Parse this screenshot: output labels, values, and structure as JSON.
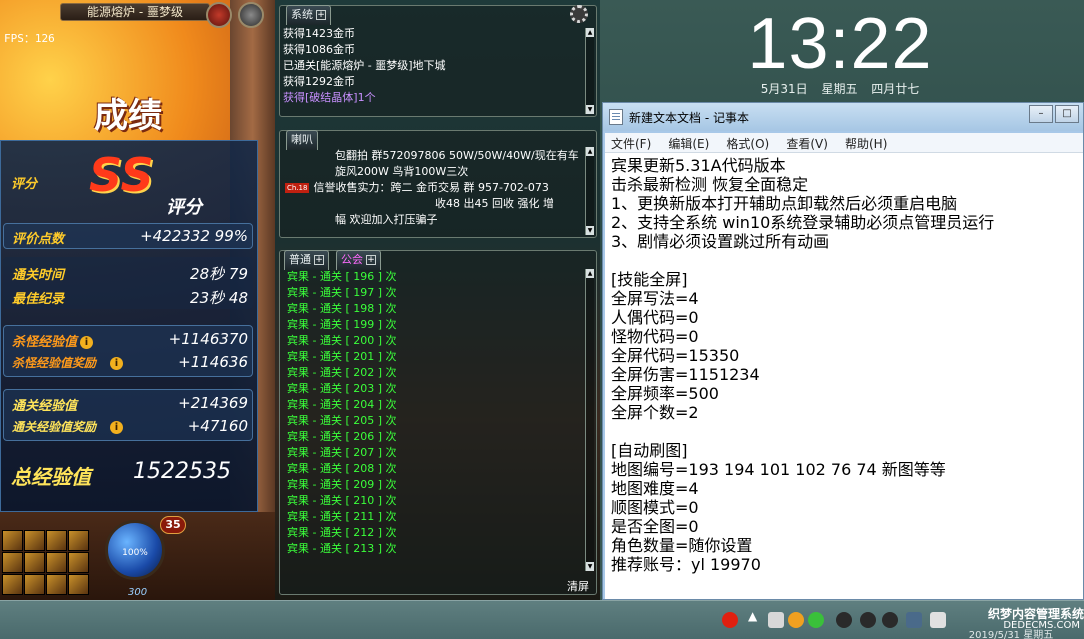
{
  "clock": {
    "time": "13:22",
    "date": "5月31日",
    "weekday": "星期五",
    "lunar": "四月廿七"
  },
  "game": {
    "map_title": "能源熔炉 - 噩梦级",
    "fps": "FPS：126",
    "results_title": "成绩",
    "grade": {
      "label": "评分",
      "grade_letters": "SS",
      "grade_word": "评分"
    },
    "rows": {
      "score_points_label": "评价点数",
      "score_points_value": "+422332  99%",
      "clear_time_label": "通关时间",
      "clear_time_value": "28秒 79",
      "best_record_label": "最佳纪录",
      "best_record_value": "23秒 48",
      "kill_exp_label": "杀怪经验值",
      "kill_exp_value": "+1146370",
      "kill_exp_bonus_label": "杀怪经验值奖励",
      "kill_exp_bonus_value": "+114636",
      "clear_exp_label": "通关经验值",
      "clear_exp_value": "+214369",
      "clear_exp_bonus_label": "通关经验值奖励",
      "clear_exp_bonus_value": "+47160",
      "total_exp_label": "总经验值",
      "total_exp_value": "1522535"
    },
    "level_badge": "35",
    "orb_percent": "100%",
    "mp_value": "300"
  },
  "system_panel": {
    "tab_label": "系统",
    "lines": [
      "获得1423金币",
      "获得1086金币",
      "已通关[能源熔炉 - 噩梦级]地下城",
      "获得1292金币",
      "获得[破结晶体]1个"
    ]
  },
  "speaker_panel": {
    "tab_label": "喇叭",
    "lines": [
      "包翻拍 群572097806 50W/50W/40W/现在有车",
      "旋风200W 鸟背100W三次",
      "信誉收售实力：跨二 金币交易 群 957-702-073",
      "收48 出45  回收 强化 增",
      "幅  欢迎加入打压骗子"
    ],
    "channel_tag": "Ch.18"
  },
  "normal_panel": {
    "tab_normal": "普通",
    "tab_guild": "公会",
    "clear_label": "清屏",
    "lines": [
      "宾果 - 通关 [ 196 ] 次",
      "宾果 - 通关 [ 197 ] 次",
      "宾果 - 通关 [ 198 ] 次",
      "宾果 - 通关 [ 199 ] 次",
      "宾果 - 通关 [ 200 ] 次",
      "宾果 - 通关 [ 201 ] 次",
      "宾果 - 通关 [ 202 ] 次",
      "宾果 - 通关 [ 203 ] 次",
      "宾果 - 通关 [ 204 ] 次",
      "宾果 - 通关 [ 205 ] 次",
      "宾果 - 通关 [ 206 ] 次",
      "宾果 - 通关 [ 207 ] 次",
      "宾果 - 通关 [ 208 ] 次",
      "宾果 - 通关 [ 209 ] 次",
      "宾果 - 通关 [ 210 ] 次",
      "宾果 - 通关 [ 211 ] 次",
      "宾果 - 通关 [ 212 ] 次",
      "宾果 - 通关 [ 213 ] 次"
    ]
  },
  "notepad": {
    "title": "新建文本文档 - 记事本",
    "menu": [
      "文件(F)",
      "编辑(E)",
      "格式(O)",
      "查看(V)",
      "帮助(H)"
    ],
    "lines": [
      "宾果更新5.31A代码版本",
      "击杀最新检测 恢复全面稳定",
      "1、更换新版本打开辅助点卸载然后必须重启电脑",
      "2、支持全系统 win10系统登录辅助必须点管理员运行",
      "3、剧情必须设置跳过所有动画",
      "",
      "[技能全屏]",
      "全屏写法=4",
      "人偶代码=0",
      "怪物代码=0",
      "全屏代码=15350",
      "全屏伤害=1151234",
      "全屏频率=500",
      "全屏个数=2",
      "",
      "[自动刷图]",
      "地图编号=193 194 101 102 76 74 新图等等",
      "地图难度=4",
      "顺图模式=0",
      "是否全图=0",
      "角色数量=随你设置",
      "推荐账号：yl 19970"
    ]
  },
  "taskbar": {
    "watermark": "织梦内容管理系统",
    "watermark_sub": "DEDECMS.COM",
    "tray_date": "2019/5/31 星期五"
  },
  "colors": {
    "chat_green": "#3aff3a",
    "label_gold": "#ffcc2a",
    "notepad_titlebar": "#a8c8e8"
  }
}
